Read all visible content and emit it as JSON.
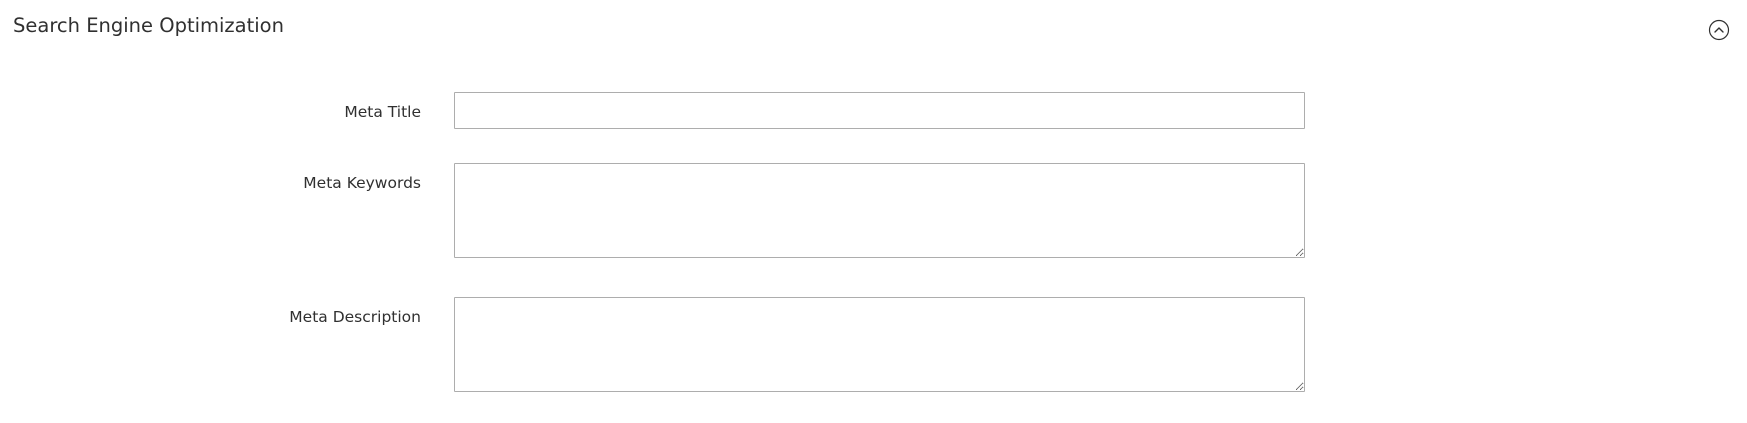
{
  "section": {
    "title": "Search Engine Optimization",
    "collapse_icon": "chevron-up-circle-icon"
  },
  "fields": {
    "meta_title": {
      "label": "Meta Title",
      "value": ""
    },
    "meta_keywords": {
      "label": "Meta Keywords",
      "value": ""
    },
    "meta_description": {
      "label": "Meta Description",
      "value": ""
    }
  }
}
